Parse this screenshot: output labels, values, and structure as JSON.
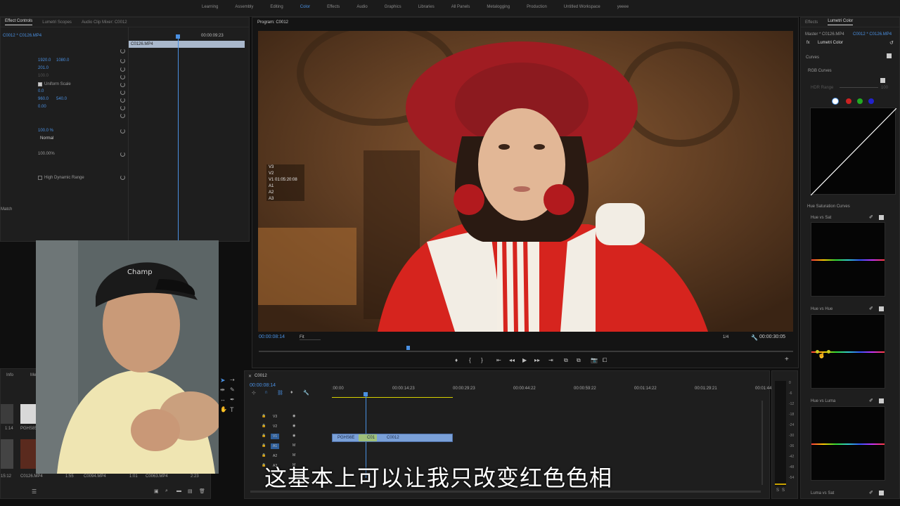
{
  "workspaces": [
    "Learning",
    "Assembly",
    "Editing",
    "Color",
    "Effects",
    "Audio",
    "Graphics",
    "Libraries",
    "All Panels",
    "Metalogging",
    "Production",
    "Untitled Workspace",
    "yeeee"
  ],
  "active_workspace_index": 3,
  "left_panel": {
    "tabs": [
      "Effect Controls",
      "Lumetri Scopes",
      "Audio Clip Mixer: C0012"
    ],
    "source_label": "C0012 * C0126.MP4",
    "timecode": "00:00:09:23",
    "clip_name": "C0126.MP4",
    "values": {
      "position_x": "1920.0",
      "position_y": "1080.0",
      "scale": "201.0",
      "scale_width": "100.0",
      "uniform_scale": "Uniform Scale",
      "rotation": "0.0",
      "anchor_x": "960.0",
      "anchor_y": "540.0",
      "antiflicker": "0.00",
      "opacity": "100.0 %",
      "blend_mode": "Normal",
      "speed": "100.00%",
      "hdr": "High Dynamic Range",
      "match": "Match"
    }
  },
  "program": {
    "title": "Program: C0012",
    "overlay_lines": [
      "V3",
      "V2",
      "V1 01:05:20:08",
      "A1",
      "A2",
      "A3"
    ],
    "current_time": "00:00:08:14",
    "fit": "Fit",
    "resolution": "1/4",
    "duration": "00:00:30:05"
  },
  "timeline": {
    "sequence": "C0012",
    "current_time": "00:00:08:14",
    "ruler": [
      ":00:00",
      "00:00:14:23",
      "00:00:29:23",
      "00:00:44:22",
      "00:00:59:22",
      "00:01:14:22",
      "00:01:29:21",
      "00:01:44"
    ],
    "tracks": [
      "V3",
      "V2",
      "V1",
      "A1",
      "A2",
      "A3"
    ],
    "clips": [
      "PGHS6E",
      "C01",
      "C0012"
    ],
    "meter_db": [
      "0",
      "-6",
      "-12",
      "-18",
      "-24",
      "-30",
      "-36",
      "-42",
      "-48",
      "-54"
    ],
    "solo_labels": [
      "S",
      "S"
    ]
  },
  "project": {
    "tabs": [
      "Info",
      "Me"
    ],
    "items": [
      "PGHS85",
      "C0126.MP4",
      "C0094.MP4",
      "C0063.MP4"
    ],
    "durations": [
      "1:14",
      "15:12",
      "1:55",
      "1:01",
      "2:23"
    ]
  },
  "lumetri": {
    "tabs": [
      "Effects",
      "Lumetri Color"
    ],
    "source": "Master * C0126.MP4",
    "target": "C0012 * C0126.MP4",
    "fx_name": "Lumetri Color",
    "section": "Curves",
    "rgb_curves": "RGB Curves",
    "hdr_range": "HDR Range",
    "hdr_value": "100",
    "hue_sat_curves": "Hue Saturation Curves",
    "graphs": [
      "Hue vs Sat",
      "Hue vs Hue",
      "Hue vs Luma",
      "Luma vs Sat"
    ],
    "channel_colors": [
      "#ffffff",
      "#d22",
      "#2b2",
      "#22d"
    ]
  },
  "subtitle": "这基本上可以让我只改变红色色相",
  "colors": {
    "accent": "#4a90e2",
    "panel": "#1e1e1e",
    "timeline_clip": "#7aa0d8",
    "playhead": "#4a90e2"
  }
}
